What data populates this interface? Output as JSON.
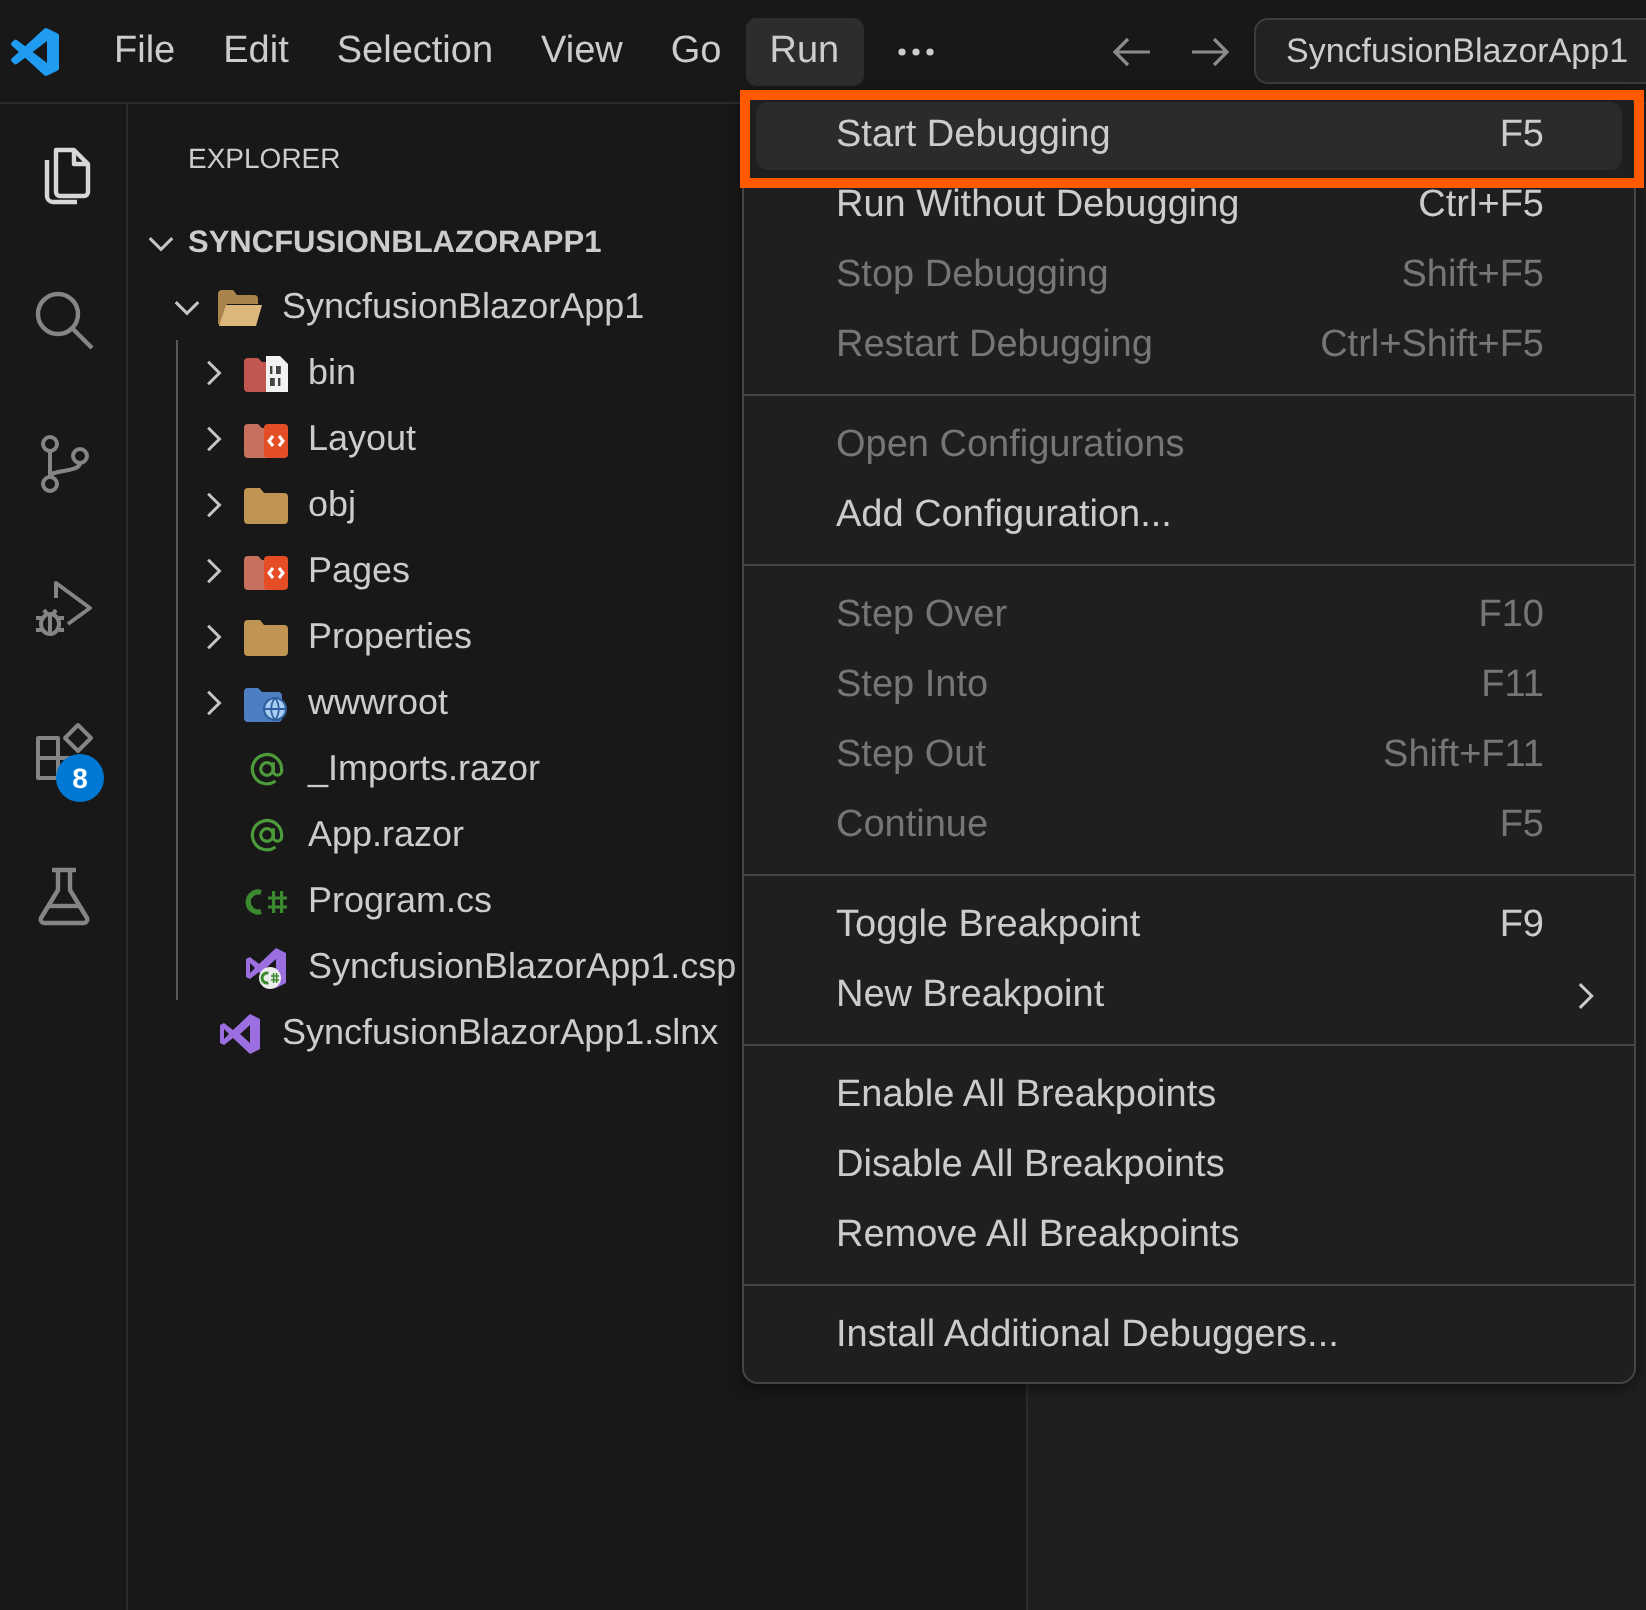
{
  "title_bar": {
    "menus": [
      {
        "label": "File",
        "selected": false
      },
      {
        "label": "Edit",
        "selected": false
      },
      {
        "label": "Selection",
        "selected": false
      },
      {
        "label": "View",
        "selected": false
      },
      {
        "label": "Go",
        "selected": false
      },
      {
        "label": "Run",
        "selected": true
      }
    ],
    "command_center": {
      "value": "SyncfusionBlazorApp1"
    }
  },
  "activity_bar": [
    {
      "kind": "files",
      "selected": true
    },
    {
      "kind": "search",
      "selected": false
    },
    {
      "kind": "branch",
      "selected": false
    },
    {
      "kind": "debug",
      "selected": false
    },
    {
      "kind": "blocks",
      "selected": false,
      "badge": "8"
    },
    {
      "kind": "flask",
      "selected": false
    }
  ],
  "explorer": {
    "title": "EXPLORER",
    "section": {
      "label": "SYNCFUSIONBLAZORAPP1",
      "expanded": true,
      "children": [
        {
          "label": "SyncfusionBlazorApp1",
          "kind": "folder",
          "expanded": true,
          "children": [
            {
              "label": "bin",
              "kind": "binfolder",
              "expanded": false
            },
            {
              "label": "Layout",
              "kind": "codefolder",
              "expanded": false
            },
            {
              "label": "obj",
              "kind": "folder",
              "expanded": false
            },
            {
              "label": "Pages",
              "kind": "codefolder",
              "expanded": false
            },
            {
              "label": "Properties",
              "kind": "folder",
              "expanded": false
            },
            {
              "label": "wwwroot",
              "kind": "webfolder",
              "expanded": false
            },
            {
              "label": "_Imports.razor",
              "kind": "razor"
            },
            {
              "label": "App.razor",
              "kind": "razor"
            },
            {
              "label": "Program.cs",
              "kind": "csharp"
            },
            {
              "label": "SyncfusionBlazorApp1.csp",
              "kind": "csproj"
            }
          ]
        },
        {
          "label": "SyncfusionBlazorApp1.slnx",
          "kind": "sln"
        }
      ]
    }
  },
  "run_menu": {
    "groups": [
      {
        "items": [
          {
            "label": "Start Debugging",
            "shortcut": "F5",
            "disabled": false,
            "selected": true,
            "outlined": true,
            "submenu": false
          },
          {
            "label": "Run Without Debugging",
            "shortcut": "Ctrl+F5",
            "disabled": false,
            "selected": false,
            "outlined": false,
            "submenu": false
          },
          {
            "label": "Stop Debugging",
            "shortcut": "Shift+F5",
            "disabled": true,
            "selected": false,
            "outlined": false,
            "submenu": false
          },
          {
            "label": "Restart Debugging",
            "shortcut": "Ctrl+Shift+F5",
            "disabled": true,
            "selected": false,
            "outlined": false,
            "submenu": false
          }
        ]
      },
      {
        "items": [
          {
            "label": "Open Configurations",
            "disabled": true,
            "selected": false,
            "outlined": false,
            "submenu": false
          },
          {
            "label": "Add Configuration...",
            "disabled": false,
            "selected": false,
            "outlined": false,
            "submenu": false
          }
        ]
      },
      {
        "items": [
          {
            "label": "Step Over",
            "shortcut": "F10",
            "disabled": true,
            "selected": false,
            "outlined": false,
            "submenu": false
          },
          {
            "label": "Step Into",
            "shortcut": "F11",
            "disabled": true,
            "selected": false,
            "outlined": false,
            "submenu": false
          },
          {
            "label": "Step Out",
            "shortcut": "Shift+F11",
            "disabled": true,
            "selected": false,
            "outlined": false,
            "submenu": false
          },
          {
            "label": "Continue",
            "shortcut": "F5",
            "disabled": true,
            "selected": false,
            "outlined": false,
            "submenu": false
          }
        ]
      },
      {
        "items": [
          {
            "label": "Toggle Breakpoint",
            "shortcut": "F9",
            "disabled": false,
            "selected": false,
            "outlined": false,
            "submenu": false
          },
          {
            "label": "New Breakpoint",
            "disabled": false,
            "selected": false,
            "outlined": false,
            "submenu": true
          }
        ]
      },
      {
        "items": [
          {
            "label": "Enable All Breakpoints",
            "disabled": false,
            "selected": false,
            "outlined": false,
            "submenu": false
          },
          {
            "label": "Disable All Breakpoints",
            "disabled": false,
            "selected": false,
            "outlined": false,
            "submenu": false
          },
          {
            "label": "Remove All Breakpoints",
            "disabled": false,
            "selected": false,
            "outlined": false,
            "submenu": false
          }
        ]
      },
      {
        "items": [
          {
            "label": "Install Additional Debuggers...",
            "disabled": false,
            "selected": false,
            "outlined": false,
            "submenu": false
          }
        ]
      }
    ]
  }
}
